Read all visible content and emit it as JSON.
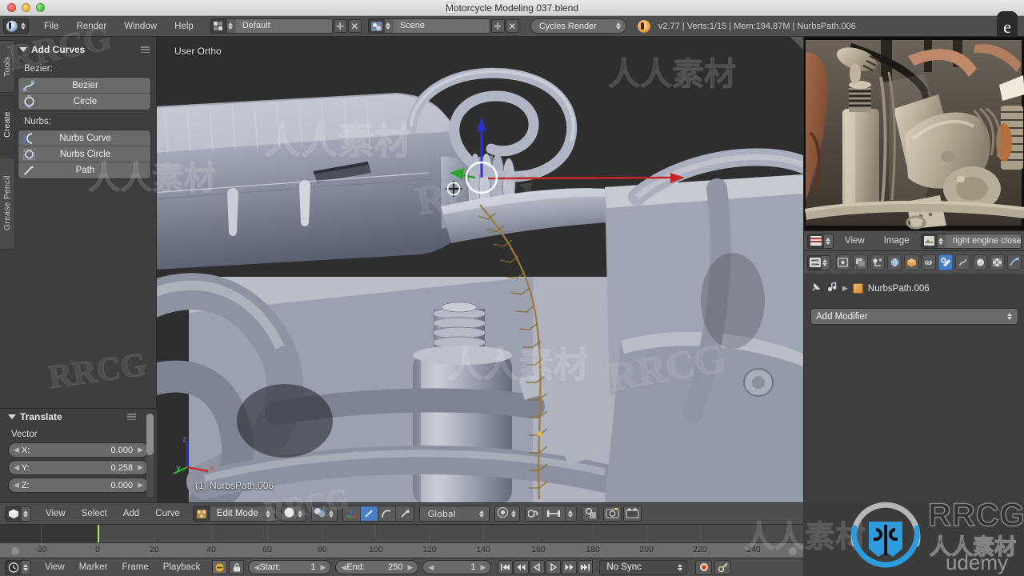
{
  "window": {
    "title": "Motorcycle Modeling 037.blend",
    "traffic_lights": [
      "close",
      "minimize",
      "zoom"
    ]
  },
  "topbar": {
    "menus": [
      "File",
      "Render",
      "Window",
      "Help"
    ],
    "screen_layout": "Default",
    "scene_name": "Scene",
    "render_engine": "Cycles Render",
    "status": "v2.77 | Verts:1/15 | Mem:194.87M | NurbsPath.006",
    "badge": "e"
  },
  "tool_shelf": {
    "tabs": [
      {
        "label": "Tools",
        "active": false
      },
      {
        "label": "Create",
        "active": true
      },
      {
        "label": "Grease Pencil",
        "active": false
      }
    ],
    "panel_title": "Add Curves",
    "groups": [
      {
        "label": "Bezier:",
        "buttons": [
          {
            "label": "Bezier",
            "icon": "bezier-curve-icon"
          },
          {
            "label": "Circle",
            "icon": "bezier-circle-icon"
          }
        ]
      },
      {
        "label": "Nurbs:",
        "buttons": [
          {
            "label": "Nurbs Curve",
            "icon": "nurbs-curve-icon"
          },
          {
            "label": "Nurbs Circle",
            "icon": "nurbs-circle-icon"
          },
          {
            "label": "Path",
            "icon": "path-icon"
          }
        ]
      }
    ]
  },
  "operator_panel": {
    "title": "Translate",
    "section_label": "Vector",
    "fields": [
      {
        "name": "X:",
        "value": "0.000"
      },
      {
        "name": "Y:",
        "value": "0.258"
      },
      {
        "name": "Z:",
        "value": "0.000"
      }
    ]
  },
  "viewport": {
    "view_label": "User Ortho",
    "object_label": "(1) NurbsPath.006",
    "axis_labels": {
      "x": "x",
      "y": "y",
      "z": "z"
    },
    "gizmo_colors": {
      "x": "#cc2222",
      "y": "#22aa33",
      "z": "#2233cc"
    }
  },
  "view3d_header": {
    "menus": [
      "View",
      "Select",
      "Add",
      "Curve"
    ],
    "mode": "Edit Mode",
    "transform_orientation": "Global",
    "editor_icon": "editor-type-3dview-icon",
    "toggles": [
      {
        "name": "manipulator-toggle",
        "on": false
      },
      {
        "name": "translate-manipulator",
        "on": true
      },
      {
        "name": "rotate-manipulator",
        "on": false
      },
      {
        "name": "scale-manipulator",
        "on": false
      }
    ],
    "snap": {
      "magnet": "snap-magnet-icon",
      "pivot": "pivot-center-icon"
    },
    "extras": [
      "proportional-edit-icon",
      "render-camera-icon",
      "render-animation-icon"
    ]
  },
  "timeline": {
    "ruler_ticks": [
      "-20",
      "0",
      "20",
      "40",
      "60",
      "80",
      "100",
      "120",
      "140",
      "160",
      "180",
      "200",
      "220",
      "240"
    ],
    "playhead_frame": "0",
    "menus": [
      "View",
      "Marker",
      "Frame",
      "Playback"
    ],
    "start_label": "Start:",
    "start_value": "1",
    "end_label": "End:",
    "end_value": "250",
    "current_frame": "1",
    "sync_mode": "No Sync",
    "nav_buttons": [
      "jump-start",
      "prev-keyframe",
      "play-reverse",
      "play",
      "next-keyframe",
      "jump-end"
    ],
    "record_button": "auto-keyframe-record",
    "keyingset_button": "keying-set-icon"
  },
  "image_editor": {
    "menus": [
      "View",
      "Image"
    ],
    "image_name": "right engine close",
    "editor_icon": "editor-type-image-icon",
    "datablock_icon": "image-datablock-icon"
  },
  "properties": {
    "tab_icons": [
      {
        "name": "render-tab-icon",
        "active": false
      },
      {
        "name": "render-layers-tab-icon",
        "active": false
      },
      {
        "name": "scene-tab-icon",
        "active": false
      },
      {
        "name": "world-tab-icon",
        "active": false
      },
      {
        "name": "object-tab-icon",
        "active": false
      },
      {
        "name": "constraints-tab-icon",
        "active": false
      },
      {
        "name": "modifiers-tab-icon",
        "active": true
      },
      {
        "name": "data-tab-icon",
        "active": false
      },
      {
        "name": "material-tab-icon",
        "active": false
      },
      {
        "name": "texture-tab-icon",
        "active": false
      },
      {
        "name": "particles-tab-icon",
        "active": false
      }
    ],
    "breadcrumb_object": "NurbsPath.006",
    "add_modifier_label": "Add Modifier",
    "pin_icon": "pin-icon",
    "editor_icon": "editor-type-properties-icon"
  },
  "watermarks": {
    "brand": "RRCG",
    "brand_cn": "人人素材",
    "platform": "udemy",
    "tiles": [
      "RRCG",
      "人人素材"
    ]
  },
  "colors": {
    "header_bg": "#4e4e4e",
    "panel_bg": "#3e3e3e",
    "viewport_bg": "#2e2e2e",
    "accent_blue": "#4b7fc4",
    "playhead_green": "#a6e85f",
    "record_red": "#d24a20"
  }
}
